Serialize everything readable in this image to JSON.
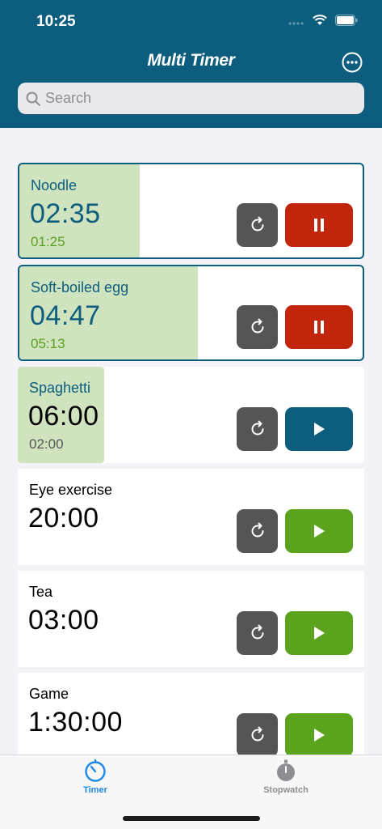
{
  "status_bar": {
    "time": "10:25"
  },
  "header": {
    "title": "Multi Timer"
  },
  "search": {
    "placeholder": "Search"
  },
  "timers": [
    {
      "name": "Noodle",
      "time": "02:35",
      "sub": "01:25",
      "state": "running",
      "progress": 0.35
    },
    {
      "name": "Soft-boiled egg",
      "time": "04:47",
      "sub": "05:13",
      "state": "running",
      "progress": 0.52
    },
    {
      "name": "Spaghetti",
      "time": "06:00",
      "sub": "02:00",
      "state": "paused",
      "progress": 0.25
    },
    {
      "name": "Eye exercise",
      "time": "20:00",
      "sub": "",
      "state": "idle",
      "progress": 0
    },
    {
      "name": "Tea",
      "time": "03:00",
      "sub": "",
      "state": "idle",
      "progress": 0
    },
    {
      "name": "Game",
      "time": "1:30:00",
      "sub": "",
      "state": "idle",
      "progress": 0
    }
  ],
  "tabs": {
    "timer": "Timer",
    "stopwatch": "Stopwatch"
  },
  "colors": {
    "header": "#0c5d7e",
    "pause": "#c1260d",
    "start_green": "#5ba31c",
    "start_blue": "#0c5d7e",
    "progress": "#cfe3bf"
  },
  "icons": {
    "reset": "reset-icon",
    "pause": "pause-icon",
    "play": "play-icon",
    "more": "more-icon",
    "search": "search-icon"
  }
}
